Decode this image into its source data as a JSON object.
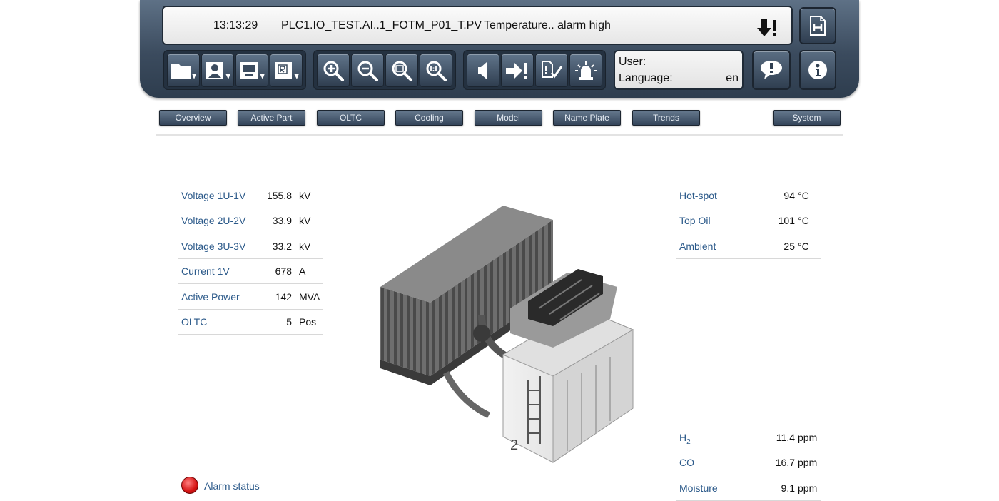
{
  "alarm_bar": {
    "time": "13:13:29",
    "tag": "PLC1.IO_TEST.AI..1_FOTM_P01_T.PV",
    "message": "Temperature.. alarm high"
  },
  "user_panel": {
    "user_label": "User:",
    "user_value": "",
    "language_label": "Language:",
    "language_value": "en"
  },
  "nav": {
    "overview": "Overview",
    "active_part": "Active Part",
    "oltc": "OLTC",
    "cooling": "Cooling",
    "model": "Model",
    "name_plate": "Name Plate",
    "trends": "Trends",
    "system": "System"
  },
  "left_table": [
    {
      "label": "Voltage 1U-1V",
      "value": "155.8",
      "unit": "kV"
    },
    {
      "label": "Voltage 2U-2V",
      "value": "33.9",
      "unit": "kV"
    },
    {
      "label": "Voltage 3U-3V",
      "value": "33.2",
      "unit": "kV"
    },
    {
      "label": "Current 1V",
      "value": "678",
      "unit": "A"
    },
    {
      "label": "Active Power",
      "value": "142",
      "unit": "MVA"
    },
    {
      "label": "OLTC",
      "value": "5",
      "unit": "Pos"
    }
  ],
  "temps_table": [
    {
      "label": "Hot-spot",
      "value": "94",
      "unit": "°C"
    },
    {
      "label": "Top Oil",
      "value": "101",
      "unit": "°C"
    },
    {
      "label": "Ambient",
      "value": "25",
      "unit": "°C"
    }
  ],
  "gas_table": [
    {
      "label_main": "H",
      "label_sub": "2",
      "value": "11.4",
      "unit": "ppm"
    },
    {
      "label_main": "CO",
      "label_sub": "",
      "value": "16.7",
      "unit": "ppm"
    },
    {
      "label_main": "Moisture",
      "label_sub": "",
      "value": "9.1",
      "unit": "ppm"
    }
  ],
  "transformer_label": "2",
  "alarm_status": {
    "label": "Alarm status",
    "color": "#d61414"
  },
  "colors": {
    "header_bg": "#3b4b5e",
    "label_blue": "#2c5a8a",
    "alarm_red": "#d61414"
  },
  "icons": {
    "file_group": [
      "open-folder-icon",
      "user-file-icon",
      "screen-file-icon",
      "report-file-icon"
    ],
    "zoom_group": [
      "zoom-in-icon",
      "zoom-out-icon",
      "zoom-fit-icon",
      "zoom-reset-icon"
    ],
    "alarm_group": [
      "mute-horn-icon",
      "acknowledge-alarm-icon",
      "confirm-list-icon",
      "alarm-beacon-icon"
    ],
    "right": [
      "hmi-home-icon",
      "alarm-bubble-icon",
      "info-icon"
    ]
  }
}
